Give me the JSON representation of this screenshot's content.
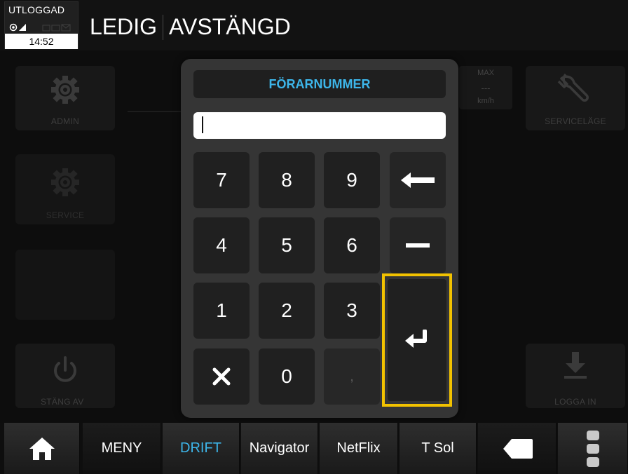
{
  "status": {
    "login_state": "UTLOGGAD",
    "time": "14:52",
    "vehicle_state": "LEDIG",
    "meter_state": "AVSTÄNGD"
  },
  "background": {
    "admin_label": "ADMIN",
    "service_label": "SERVICE",
    "power_label": "STÄNG AV",
    "servicemode_label": "SERVICELÄGE",
    "login_label": "LOGGA IN",
    "speed_max_label": "MAX",
    "speed_value": "---",
    "speed_unit": "km/h"
  },
  "modal": {
    "title": "FÖRARNUMMER",
    "input_value": "",
    "keys": {
      "k7": "7",
      "k8": "8",
      "k9": "9",
      "k4": "4",
      "k5": "5",
      "k6": "6",
      "k1": "1",
      "k2": "2",
      "k3": "3",
      "k0": "0",
      "comma": ","
    },
    "icons": {
      "backspace": "arrow-left-icon",
      "minus": "minus-icon",
      "clear": "close-icon",
      "enter": "enter-icon"
    },
    "highlight_color": "#f2c200",
    "title_color": "#3db6ea"
  },
  "nav": {
    "meny": "MENY",
    "drift": "DRIFT",
    "navigator": "Navigator",
    "netflix": "NetFlix",
    "tsol": "T Sol",
    "active_color": "#3db6ea"
  }
}
